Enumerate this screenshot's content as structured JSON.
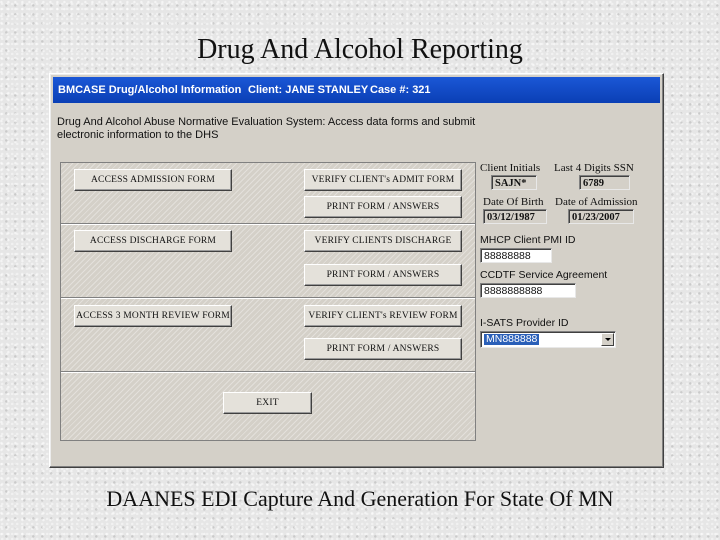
{
  "slide": {
    "title": "Drug And Alcohol Reporting",
    "caption": "DAANES EDI Capture And Generation For State Of MN"
  },
  "window": {
    "title": "BMCASE Drug/Alcohol Information",
    "client": "Client: JANE STANLEY",
    "case": "Case #: 321",
    "description": "Drug And Alcohol Abuse Normative Evaluation System: Access data forms and submit electronic information to the DHS"
  },
  "buttons": {
    "access_admission": "ACCESS ADMISSION FORM",
    "verify_admit": "VERIFY CLIENT's ADMIT FORM",
    "print_1": "PRINT FORM / ANSWERS",
    "access_discharge": "ACCESS DISCHARGE FORM",
    "verify_discharge": "VERIFY CLIENTS DISCHARGE",
    "print_2": "PRINT FORM / ANSWERS",
    "access_review": "ACCESS 3 MONTH REVIEW FORM",
    "verify_review": "VERIFY CLIENT's REVIEW FORM",
    "print_3": "PRINT FORM / ANSWERS",
    "exit": "EXIT"
  },
  "fields": {
    "client_initials_label": "Client Initials",
    "client_initials": "SAJN*",
    "ssn_label": "Last 4 Digits SSN",
    "ssn": "6789",
    "dob_label": "Date Of Birth",
    "dob": "03/12/1987",
    "admission_label": "Date of Admission",
    "admission": "01/23/2007",
    "mhcp_label": "MHCP Client PMI ID",
    "mhcp": "88888888",
    "ccdtf_label": "CCDTF Service Agreement",
    "ccdtf": "8888888888",
    "isats_label": "I-SATS Provider ID",
    "isats": "MN888888"
  }
}
